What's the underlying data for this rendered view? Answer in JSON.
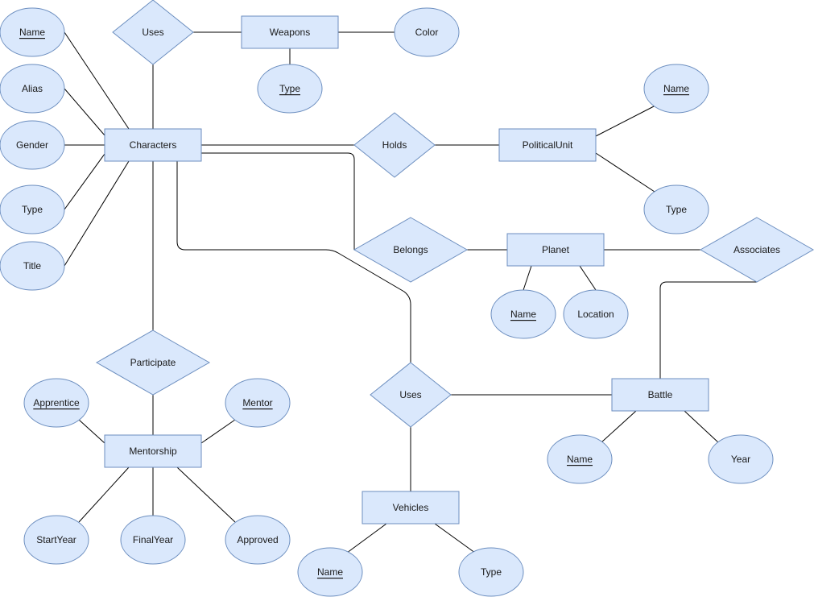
{
  "diagram": {
    "type": "entity-relationship",
    "colors": {
      "fill": "#dae8fc",
      "stroke": "#6c8ebf",
      "edge": "#000000",
      "text": "#1a1a1a"
    },
    "entities": [
      {
        "id": "characters",
        "label": "Characters"
      },
      {
        "id": "weapons",
        "label": "Weapons"
      },
      {
        "id": "politicalunit",
        "label": "PoliticalUnit"
      },
      {
        "id": "planet",
        "label": "Planet"
      },
      {
        "id": "mentorship",
        "label": "Mentorship"
      },
      {
        "id": "vehicles",
        "label": "Vehicles"
      },
      {
        "id": "battle",
        "label": "Battle"
      }
    ],
    "relationships": [
      {
        "id": "uses-weapons",
        "label": "Uses"
      },
      {
        "id": "holds",
        "label": "Holds"
      },
      {
        "id": "belongs",
        "label": "Belongs"
      },
      {
        "id": "associates",
        "label": "Associates"
      },
      {
        "id": "participate",
        "label": "Participate"
      },
      {
        "id": "uses-vehicles",
        "label": "Uses"
      }
    ],
    "attributes": [
      {
        "id": "char-name",
        "label": "Name",
        "key": true,
        "owner": "characters"
      },
      {
        "id": "char-alias",
        "label": "Alias",
        "key": false,
        "owner": "characters"
      },
      {
        "id": "char-gender",
        "label": "Gender",
        "key": false,
        "owner": "characters"
      },
      {
        "id": "char-type",
        "label": "Type",
        "key": false,
        "owner": "characters"
      },
      {
        "id": "char-title",
        "label": "Title",
        "key": false,
        "owner": "characters"
      },
      {
        "id": "weapon-type",
        "label": "Type",
        "key": true,
        "owner": "weapons"
      },
      {
        "id": "weapon-color",
        "label": "Color",
        "key": false,
        "owner": "weapons"
      },
      {
        "id": "pu-name",
        "label": "Name",
        "key": true,
        "owner": "politicalunit"
      },
      {
        "id": "pu-type",
        "label": "Type",
        "key": false,
        "owner": "politicalunit"
      },
      {
        "id": "planet-name",
        "label": "Name",
        "key": true,
        "owner": "planet"
      },
      {
        "id": "planet-location",
        "label": "Location",
        "key": false,
        "owner": "planet"
      },
      {
        "id": "ment-apprentice",
        "label": "Apprentice",
        "key": true,
        "owner": "mentorship"
      },
      {
        "id": "ment-mentor",
        "label": "Mentor",
        "key": true,
        "owner": "mentorship"
      },
      {
        "id": "ment-startyear",
        "label": "StartYear",
        "key": false,
        "owner": "mentorship"
      },
      {
        "id": "ment-finalyear",
        "label": "FinalYear",
        "key": false,
        "owner": "mentorship"
      },
      {
        "id": "ment-approved",
        "label": "Approved",
        "key": false,
        "owner": "mentorship"
      },
      {
        "id": "veh-name",
        "label": "Name",
        "key": true,
        "owner": "vehicles"
      },
      {
        "id": "veh-type",
        "label": "Type",
        "key": false,
        "owner": "vehicles"
      },
      {
        "id": "battle-name",
        "label": "Name",
        "key": true,
        "owner": "battle"
      },
      {
        "id": "battle-year",
        "label": "Year",
        "key": false,
        "owner": "battle"
      }
    ],
    "connections": [
      [
        "characters",
        "uses-weapons"
      ],
      [
        "uses-weapons",
        "weapons"
      ],
      [
        "characters",
        "holds"
      ],
      [
        "holds",
        "politicalunit"
      ],
      [
        "characters",
        "belongs"
      ],
      [
        "belongs",
        "planet"
      ],
      [
        "planet",
        "associates"
      ],
      [
        "associates",
        "battle"
      ],
      [
        "characters",
        "participate"
      ],
      [
        "participate",
        "mentorship"
      ],
      [
        "characters",
        "uses-vehicles"
      ],
      [
        "uses-vehicles",
        "vehicles"
      ],
      [
        "uses-vehicles",
        "battle"
      ]
    ]
  }
}
